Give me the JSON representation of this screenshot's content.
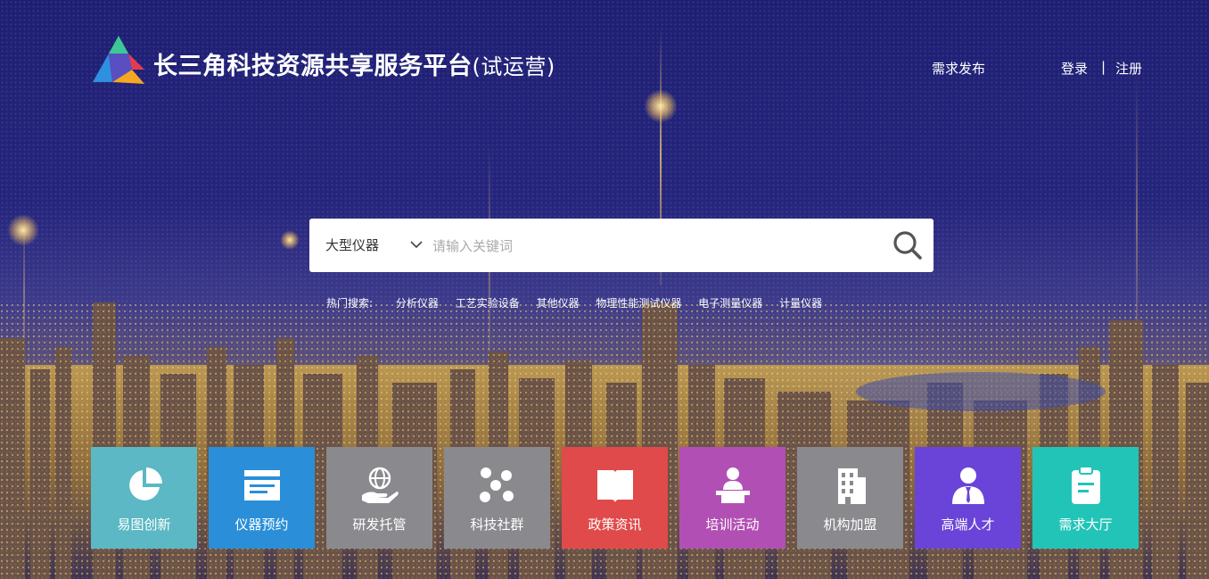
{
  "header": {
    "site_title": "长三角科技资源共享服务平台",
    "site_title_suffix": "(试运营)",
    "nav_demand_publish": "需求发布",
    "nav_login": "登录",
    "nav_separator": "|",
    "nav_register": "注册"
  },
  "search": {
    "category_selected": "大型仪器",
    "placeholder": "请输入关键词",
    "value": ""
  },
  "hot_search": {
    "label": "热门搜索:",
    "items": [
      "分析仪器",
      "工艺实验设备",
      "其他仪器",
      "物理性能测试仪器",
      "电子测量仪器",
      "计量仪器"
    ]
  },
  "tiles": [
    {
      "label": "易图创新",
      "icon": "pie-chart-icon",
      "color": "#5bb8c4"
    },
    {
      "label": "仪器预约",
      "icon": "calendar-card-icon",
      "color": "#2a8fd8"
    },
    {
      "label": "研发托管",
      "icon": "globe-hand-icon",
      "color": "#8a8a8e"
    },
    {
      "label": "科技社群",
      "icon": "community-dots-icon",
      "color": "#8a8a8e"
    },
    {
      "label": "政策资讯",
      "icon": "book-icon",
      "color": "#e04a4a"
    },
    {
      "label": "培训活动",
      "icon": "podium-speaker-icon",
      "color": "#b24fb4"
    },
    {
      "label": "机构加盟",
      "icon": "building-icon",
      "color": "#8a8a8e"
    },
    {
      "label": "高端人才",
      "icon": "person-suit-icon",
      "color": "#6a44d8"
    },
    {
      "label": "需求大厅",
      "icon": "clipboard-icon",
      "color": "#23c4b8"
    }
  ]
}
